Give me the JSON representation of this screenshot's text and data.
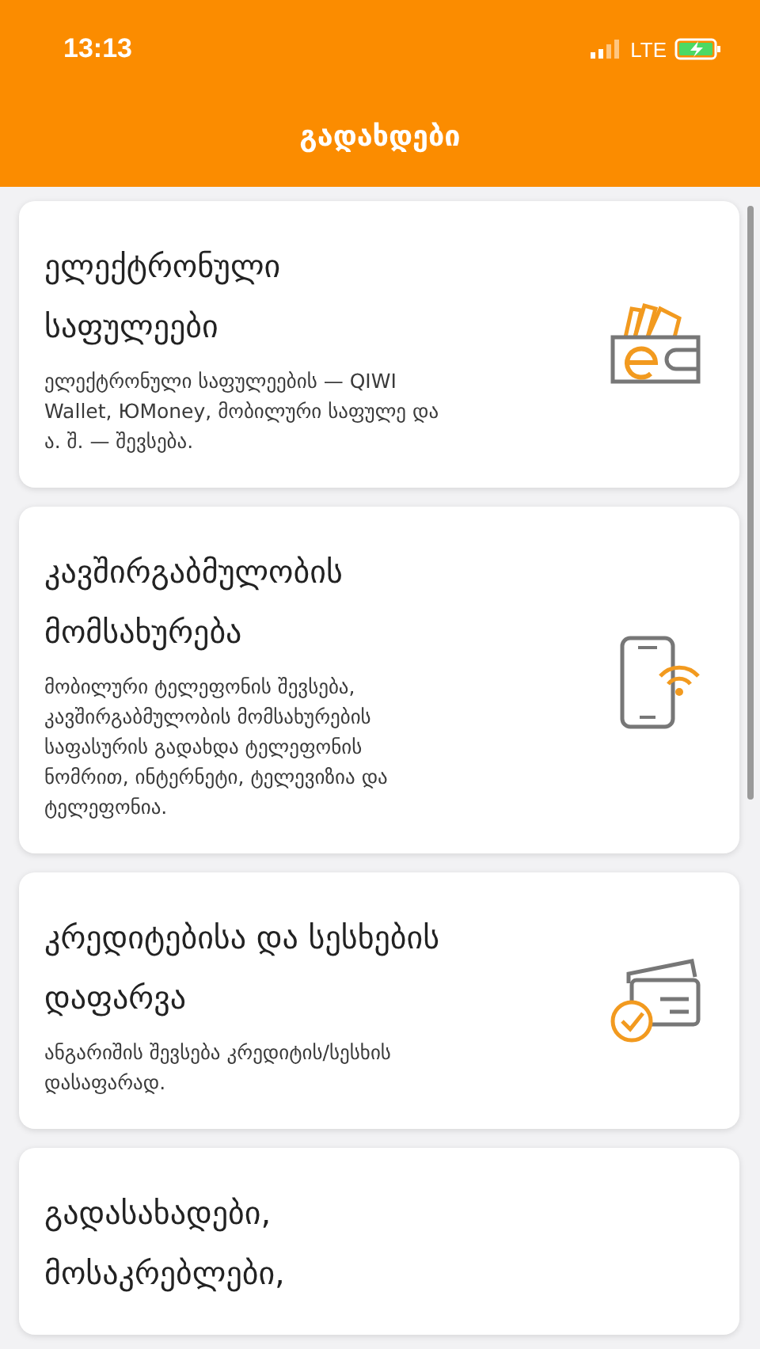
{
  "status_bar": {
    "time": "13:13",
    "network": "LTE"
  },
  "header": {
    "title": "გადახდები"
  },
  "categories": [
    {
      "title": "ელექტრონული საფულეები",
      "description": "ელექტრონული საფულეების — QIWI Wallet, ЮMoney, მობილური საფულე და ა. შ. — შევსება.",
      "kind": "wallet"
    },
    {
      "title": "კავშირგაბმულობის მომსახურება",
      "description": "მობილური ტელეფონის შევსება, კავშირგაბმულობის მომსახურების საფასურის გადახდა ტელეფონის ნომრით, ინტერნეტი, ტელევიზია და ტელეფონია.",
      "kind": "phone"
    },
    {
      "title": "კრედიტებისა და სესხების დაფარვა",
      "description": "ანგარიშის შევსება კრედიტის/სესხის დასაფარად.",
      "kind": "card"
    },
    {
      "title": "გადასახადები, მოსაკრებლები,"
    }
  ]
}
